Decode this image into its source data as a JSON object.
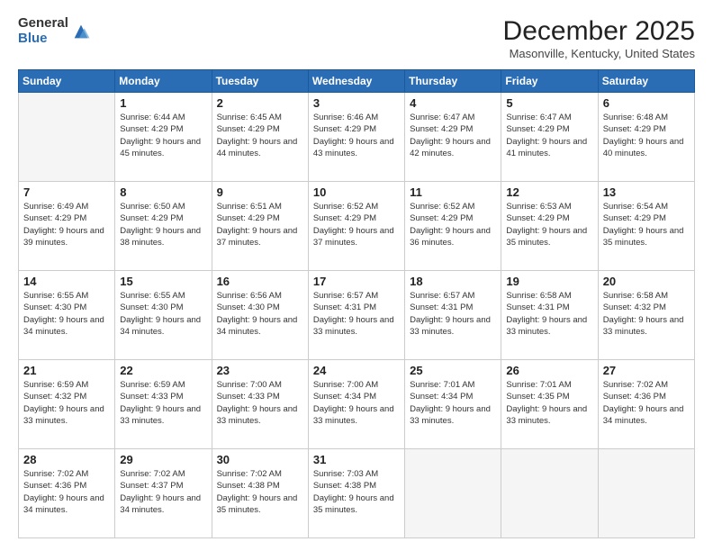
{
  "logo": {
    "general": "General",
    "blue": "Blue"
  },
  "header": {
    "month": "December 2025",
    "location": "Masonville, Kentucky, United States"
  },
  "weekdays": [
    "Sunday",
    "Monday",
    "Tuesday",
    "Wednesday",
    "Thursday",
    "Friday",
    "Saturday"
  ],
  "weeks": [
    [
      {
        "day": "",
        "sunrise": "",
        "sunset": "",
        "daylight": ""
      },
      {
        "day": "1",
        "sunrise": "Sunrise: 6:44 AM",
        "sunset": "Sunset: 4:29 PM",
        "daylight": "Daylight: 9 hours and 45 minutes."
      },
      {
        "day": "2",
        "sunrise": "Sunrise: 6:45 AM",
        "sunset": "Sunset: 4:29 PM",
        "daylight": "Daylight: 9 hours and 44 minutes."
      },
      {
        "day": "3",
        "sunrise": "Sunrise: 6:46 AM",
        "sunset": "Sunset: 4:29 PM",
        "daylight": "Daylight: 9 hours and 43 minutes."
      },
      {
        "day": "4",
        "sunrise": "Sunrise: 6:47 AM",
        "sunset": "Sunset: 4:29 PM",
        "daylight": "Daylight: 9 hours and 42 minutes."
      },
      {
        "day": "5",
        "sunrise": "Sunrise: 6:47 AM",
        "sunset": "Sunset: 4:29 PM",
        "daylight": "Daylight: 9 hours and 41 minutes."
      },
      {
        "day": "6",
        "sunrise": "Sunrise: 6:48 AM",
        "sunset": "Sunset: 4:29 PM",
        "daylight": "Daylight: 9 hours and 40 minutes."
      }
    ],
    [
      {
        "day": "7",
        "sunrise": "Sunrise: 6:49 AM",
        "sunset": "Sunset: 4:29 PM",
        "daylight": "Daylight: 9 hours and 39 minutes."
      },
      {
        "day": "8",
        "sunrise": "Sunrise: 6:50 AM",
        "sunset": "Sunset: 4:29 PM",
        "daylight": "Daylight: 9 hours and 38 minutes."
      },
      {
        "day": "9",
        "sunrise": "Sunrise: 6:51 AM",
        "sunset": "Sunset: 4:29 PM",
        "daylight": "Daylight: 9 hours and 37 minutes."
      },
      {
        "day": "10",
        "sunrise": "Sunrise: 6:52 AM",
        "sunset": "Sunset: 4:29 PM",
        "daylight": "Daylight: 9 hours and 37 minutes."
      },
      {
        "day": "11",
        "sunrise": "Sunrise: 6:52 AM",
        "sunset": "Sunset: 4:29 PM",
        "daylight": "Daylight: 9 hours and 36 minutes."
      },
      {
        "day": "12",
        "sunrise": "Sunrise: 6:53 AM",
        "sunset": "Sunset: 4:29 PM",
        "daylight": "Daylight: 9 hours and 35 minutes."
      },
      {
        "day": "13",
        "sunrise": "Sunrise: 6:54 AM",
        "sunset": "Sunset: 4:29 PM",
        "daylight": "Daylight: 9 hours and 35 minutes."
      }
    ],
    [
      {
        "day": "14",
        "sunrise": "Sunrise: 6:55 AM",
        "sunset": "Sunset: 4:30 PM",
        "daylight": "Daylight: 9 hours and 34 minutes."
      },
      {
        "day": "15",
        "sunrise": "Sunrise: 6:55 AM",
        "sunset": "Sunset: 4:30 PM",
        "daylight": "Daylight: 9 hours and 34 minutes."
      },
      {
        "day": "16",
        "sunrise": "Sunrise: 6:56 AM",
        "sunset": "Sunset: 4:30 PM",
        "daylight": "Daylight: 9 hours and 34 minutes."
      },
      {
        "day": "17",
        "sunrise": "Sunrise: 6:57 AM",
        "sunset": "Sunset: 4:31 PM",
        "daylight": "Daylight: 9 hours and 33 minutes."
      },
      {
        "day": "18",
        "sunrise": "Sunrise: 6:57 AM",
        "sunset": "Sunset: 4:31 PM",
        "daylight": "Daylight: 9 hours and 33 minutes."
      },
      {
        "day": "19",
        "sunrise": "Sunrise: 6:58 AM",
        "sunset": "Sunset: 4:31 PM",
        "daylight": "Daylight: 9 hours and 33 minutes."
      },
      {
        "day": "20",
        "sunrise": "Sunrise: 6:58 AM",
        "sunset": "Sunset: 4:32 PM",
        "daylight": "Daylight: 9 hours and 33 minutes."
      }
    ],
    [
      {
        "day": "21",
        "sunrise": "Sunrise: 6:59 AM",
        "sunset": "Sunset: 4:32 PM",
        "daylight": "Daylight: 9 hours and 33 minutes."
      },
      {
        "day": "22",
        "sunrise": "Sunrise: 6:59 AM",
        "sunset": "Sunset: 4:33 PM",
        "daylight": "Daylight: 9 hours and 33 minutes."
      },
      {
        "day": "23",
        "sunrise": "Sunrise: 7:00 AM",
        "sunset": "Sunset: 4:33 PM",
        "daylight": "Daylight: 9 hours and 33 minutes."
      },
      {
        "day": "24",
        "sunrise": "Sunrise: 7:00 AM",
        "sunset": "Sunset: 4:34 PM",
        "daylight": "Daylight: 9 hours and 33 minutes."
      },
      {
        "day": "25",
        "sunrise": "Sunrise: 7:01 AM",
        "sunset": "Sunset: 4:34 PM",
        "daylight": "Daylight: 9 hours and 33 minutes."
      },
      {
        "day": "26",
        "sunrise": "Sunrise: 7:01 AM",
        "sunset": "Sunset: 4:35 PM",
        "daylight": "Daylight: 9 hours and 33 minutes."
      },
      {
        "day": "27",
        "sunrise": "Sunrise: 7:02 AM",
        "sunset": "Sunset: 4:36 PM",
        "daylight": "Daylight: 9 hours and 34 minutes."
      }
    ],
    [
      {
        "day": "28",
        "sunrise": "Sunrise: 7:02 AM",
        "sunset": "Sunset: 4:36 PM",
        "daylight": "Daylight: 9 hours and 34 minutes."
      },
      {
        "day": "29",
        "sunrise": "Sunrise: 7:02 AM",
        "sunset": "Sunset: 4:37 PM",
        "daylight": "Daylight: 9 hours and 34 minutes."
      },
      {
        "day": "30",
        "sunrise": "Sunrise: 7:02 AM",
        "sunset": "Sunset: 4:38 PM",
        "daylight": "Daylight: 9 hours and 35 minutes."
      },
      {
        "day": "31",
        "sunrise": "Sunrise: 7:03 AM",
        "sunset": "Sunset: 4:38 PM",
        "daylight": "Daylight: 9 hours and 35 minutes."
      },
      {
        "day": "",
        "sunrise": "",
        "sunset": "",
        "daylight": ""
      },
      {
        "day": "",
        "sunrise": "",
        "sunset": "",
        "daylight": ""
      },
      {
        "day": "",
        "sunrise": "",
        "sunset": "",
        "daylight": ""
      }
    ]
  ]
}
